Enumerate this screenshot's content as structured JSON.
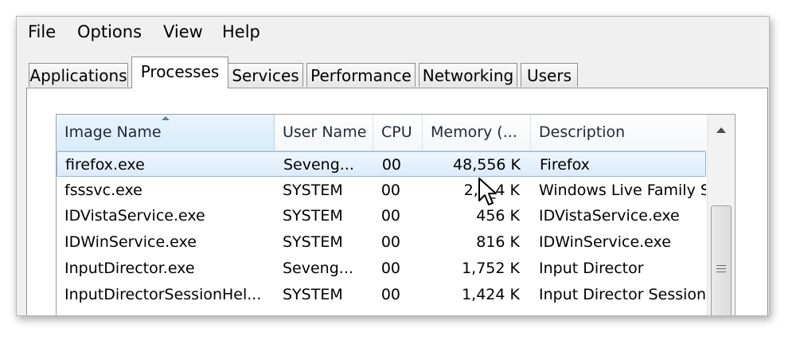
{
  "menu": [
    "File",
    "Options",
    "View",
    "Help"
  ],
  "tabs": [
    {
      "label": "Applications",
      "active": false
    },
    {
      "label": "Processes",
      "active": true
    },
    {
      "label": "Services",
      "active": false
    },
    {
      "label": "Performance",
      "active": false
    },
    {
      "label": "Networking",
      "active": false
    },
    {
      "label": "Users",
      "active": false
    }
  ],
  "columns": {
    "name": "Image Name",
    "user": "User Name",
    "cpu": "CPU",
    "memory": "Memory (...",
    "description": "Description"
  },
  "rows": [
    {
      "name": "firefox.exe",
      "user": "Seveng...",
      "cpu": "00",
      "memory": "48,556 K",
      "description": "Firefox",
      "selected": true
    },
    {
      "name": "fsssvc.exe",
      "user": "SYSTEM",
      "cpu": "00",
      "memory": "2,8_4 K",
      "description": "Windows Live Family Sa",
      "selected": false
    },
    {
      "name": "IDVistaService.exe",
      "user": "SYSTEM",
      "cpu": "00",
      "memory": "456 K",
      "description": "IDVistaService.exe",
      "selected": false
    },
    {
      "name": "IDWinService.exe",
      "user": "SYSTEM",
      "cpu": "00",
      "memory": "816 K",
      "description": "IDWinService.exe",
      "selected": false
    },
    {
      "name": "InputDirector.exe",
      "user": "Seveng...",
      "cpu": "00",
      "memory": "1,752 K",
      "description": "Input Director",
      "selected": false
    },
    {
      "name": "InputDirectorSessionHel...",
      "user": "SYSTEM",
      "cpu": "00",
      "memory": "1,424 K",
      "description": "Input Director Session I",
      "selected": false
    }
  ],
  "colors": {
    "selection": "#dcebfa",
    "selection_border": "#8fb8e6",
    "header_text": "#1e2a3a"
  },
  "icons": {
    "sort": "sort-ascending-icon",
    "scroll_up": "scroll-up-arrow-icon",
    "cursor": "mouse-pointer-icon"
  }
}
